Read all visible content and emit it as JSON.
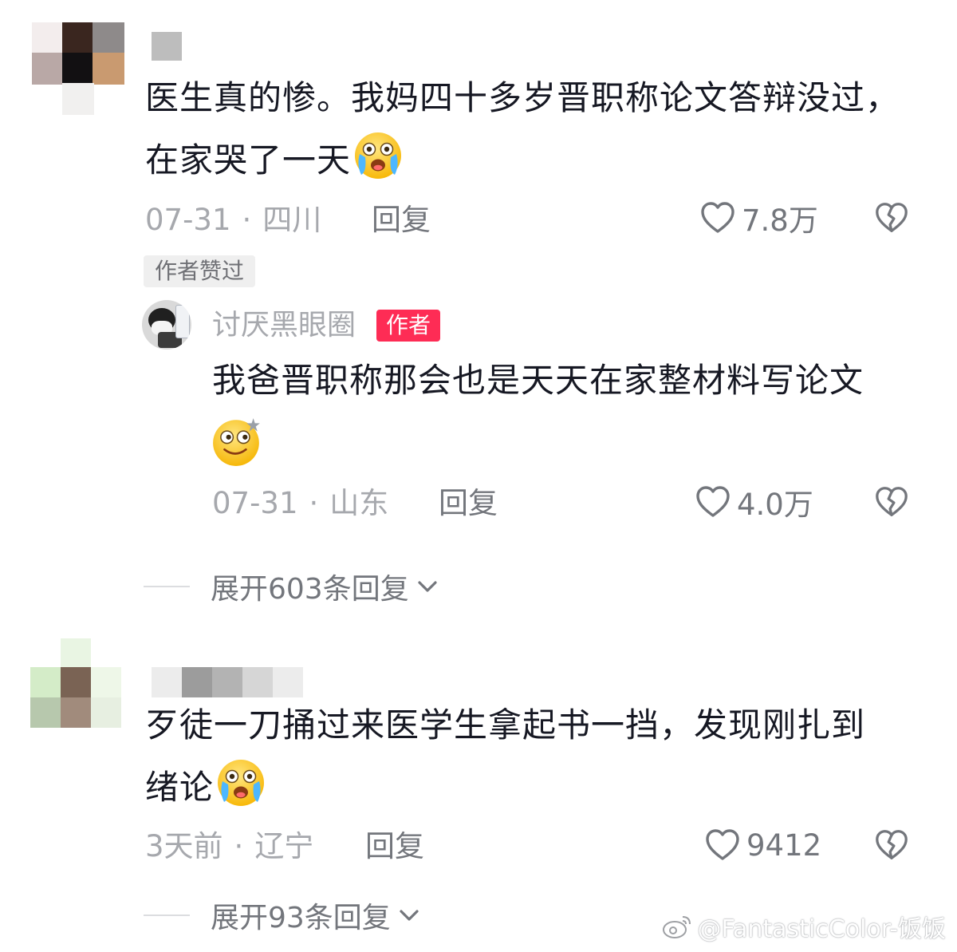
{
  "colors": {
    "text_primary": "#161823",
    "text_meta": "#a6a8ad",
    "accent_author": "#fe2c55"
  },
  "comments": [
    {
      "text_line1": "医生真的惨。我妈四十多岁晋职称论文答辩没过，",
      "text_line2": "在家哭了一天",
      "emoji": "crying-laughing-emoji",
      "date": "07-31",
      "dot": "·",
      "location": "四川",
      "reply_label": "回复",
      "likes": "7.8万",
      "author_liked_badge": "作者赞过",
      "reply": {
        "username": "讨厌黑眼圈",
        "author_tag": "作者",
        "text": "我爸晋职称那会也是天天在家整材料写论文",
        "emoji": "dazed-emoji",
        "date": "07-31",
        "dot": "·",
        "location": "山东",
        "reply_label": "回复",
        "likes": "4.0万"
      },
      "expand_label": "展开603条回复"
    },
    {
      "text_line1": "歹徒一刀捅过来医学生拿起书一挡，发现刚扎到",
      "text_line2": "绪论",
      "emoji": "crying-laughing-emoji",
      "date": "3天前",
      "dot": "·",
      "location": "辽宁",
      "reply_label": "回复",
      "likes": "9412",
      "expand_label": "展开93条回复"
    }
  ],
  "watermark": "@FantasticColor-饭饭"
}
